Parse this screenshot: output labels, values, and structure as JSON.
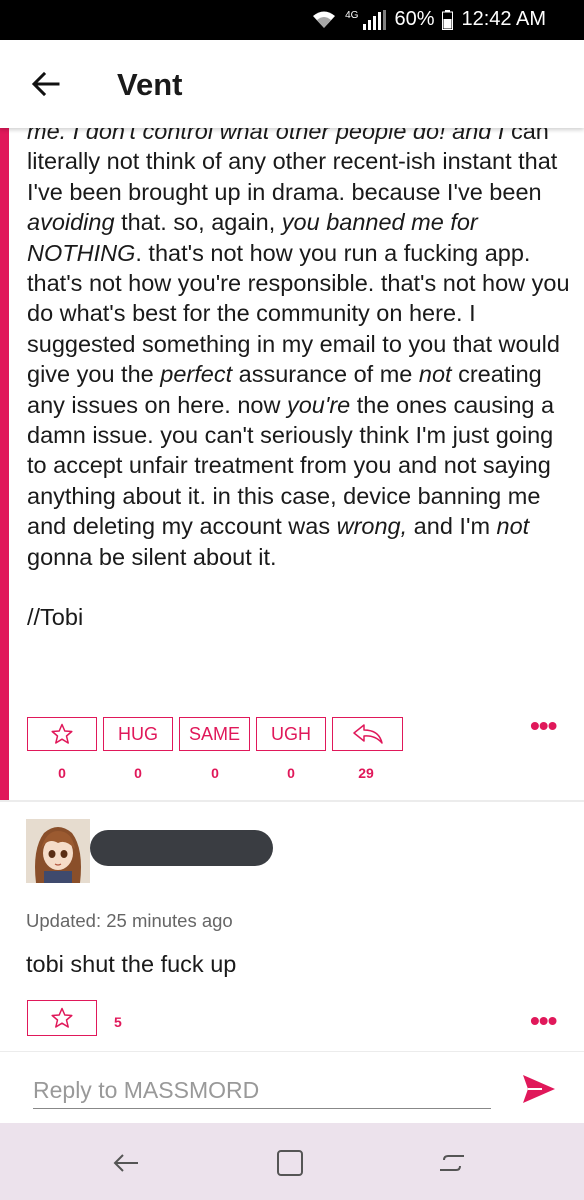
{
  "status_bar": {
    "network_label": "4G",
    "battery": "60%",
    "time": "12:42 AM",
    "icons": [
      "wifi-icon",
      "signal-icon",
      "battery-icon"
    ]
  },
  "app_bar": {
    "title": "Vent",
    "back_icon": "arrow-left-icon"
  },
  "post": {
    "accent_color": "#e0185a",
    "clipped_line": "me. I don't control what other people do! and I",
    "segments": [
      {
        "text": "can literally not think of any other recent-ish instant that I've been brought up in drama. because I've been "
      },
      {
        "text": "avoiding",
        "em": true
      },
      {
        "text": " that. so, again, "
      },
      {
        "text": "you banned me for NOTHING",
        "em": true
      },
      {
        "text": ". that's not how you run a fucking app. that's not how you're responsible. that's not how you do what's best for the community on here. I suggested something in my email to you that would give you the "
      },
      {
        "text": "perfect",
        "em": true
      },
      {
        "text": " assurance of me "
      },
      {
        "text": "not",
        "em": true
      },
      {
        "text": " creating any issues on here. now "
      },
      {
        "text": "you're",
        "em": true
      },
      {
        "text": " the ones causing a damn issue. you can't seriously think I'm just going to accept unfair treatment from you and not saying anything about it. in this case, device banning me and deleting my account was "
      },
      {
        "text": "wrong,",
        "em": true
      },
      {
        "text": " and I'm "
      },
      {
        "text": "not",
        "em": true
      },
      {
        "text": " gonna be silent about it."
      }
    ],
    "signature": "//Tobi",
    "reactions": [
      {
        "label": "",
        "icon": "star-icon",
        "count": "0"
      },
      {
        "label": "HUG",
        "count": "0"
      },
      {
        "label": "SAME",
        "count": "0"
      },
      {
        "label": "UGH",
        "count": "0"
      },
      {
        "label": "",
        "icon": "reply-arrow-icon",
        "count": "29"
      }
    ],
    "more_icon": "more-dots-icon"
  },
  "comment": {
    "updated": "Updated: 25 minutes ago",
    "text": "tobi shut the fuck up",
    "star_count": "5",
    "more_icon": "more-dots-icon"
  },
  "reply": {
    "placeholder": "Reply to MASSMORD",
    "send_icon": "send-icon"
  },
  "nav_bar": {
    "icons": [
      "nav-back-icon",
      "nav-home-icon",
      "nav-recents-icon"
    ]
  }
}
